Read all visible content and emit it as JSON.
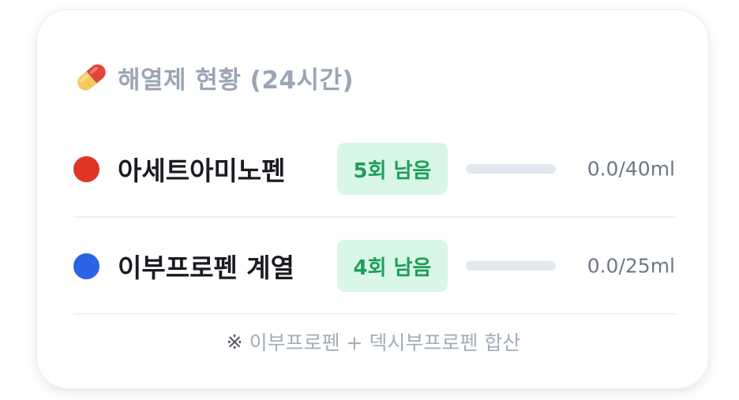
{
  "card": {
    "title": "해열제 현황 (24시간)",
    "title_icon": "pill-icon"
  },
  "medications": [
    {
      "name": "아세트아미노펜",
      "color": "#e03524",
      "badge": "5회 남음",
      "current_ml": 0.0,
      "max_ml": 40,
      "amount_text": "0.0/40ml",
      "progress_fraction": 0
    },
    {
      "name": "이부프로펜 계열",
      "color": "#2b63e6",
      "badge": "4회 남음",
      "current_ml": 0.0,
      "max_ml": 25,
      "amount_text": "0.0/25ml",
      "progress_fraction": 0
    }
  ],
  "footnote": {
    "mark": "※",
    "text": "이부프로펜 + 덱시부프로펜 합산"
  },
  "colors": {
    "badge_bg": "#d8f7e6",
    "badge_text": "#1f9d5a",
    "bar_track": "#e3e8ee"
  }
}
